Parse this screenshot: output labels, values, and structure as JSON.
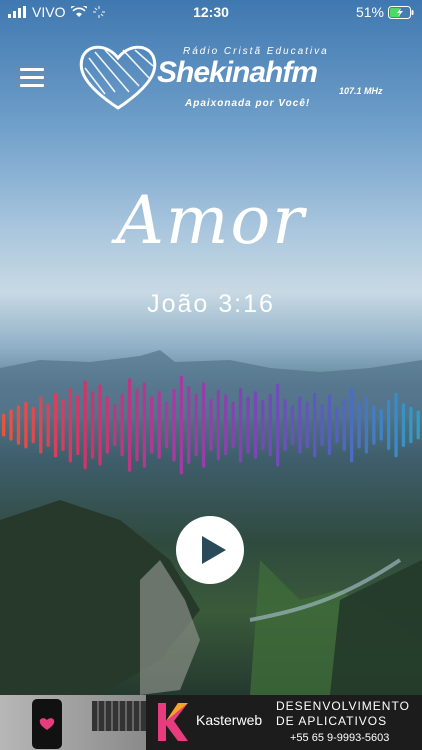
{
  "status_bar": {
    "carrier": "VIVO",
    "time": "12:30",
    "battery": "51%",
    "icons": [
      "signal-icon",
      "wifi-icon",
      "loading-icon",
      "battery-icon"
    ]
  },
  "logo": {
    "tagline": "Rádio Cristã Educativa",
    "name": "Shekinahfm",
    "frequency": "107.1 MHz",
    "slogan": "Apaixonada por Você!",
    "icon": "heart-icon"
  },
  "content": {
    "title": "Amor",
    "verse": "João 3:16"
  },
  "player": {
    "icon": "play-icon",
    "waveform_levels": [
      0.22,
      0.3,
      0.38,
      0.45,
      0.35,
      0.55,
      0.42,
      0.62,
      0.5,
      0.72,
      0.58,
      0.85,
      0.65,
      0.78,
      0.55,
      0.4,
      0.6,
      0.9,
      0.7,
      0.82,
      0.55,
      0.65,
      0.45,
      0.7,
      0.95,
      0.75,
      0.6,
      0.82,
      0.5,
      0.68,
      0.58,
      0.45,
      0.72,
      0.55,
      0.65,
      0.48,
      0.6,
      0.8,
      0.5,
      0.38,
      0.55,
      0.45,
      0.62,
      0.4,
      0.58,
      0.35,
      0.5,
      0.72,
      0.45,
      0.55,
      0.38,
      0.3,
      0.48,
      0.62,
      0.42,
      0.35,
      0.28
    ],
    "waveform_colors": [
      "#e8553f",
      "#d0346b",
      "#a83aa0",
      "#7d45b6",
      "#5560c2",
      "#2e9ec8"
    ]
  },
  "ad": {
    "brand": "Kasterweb",
    "headline1": "DESENVOLVIMENTO",
    "headline2": "DE APLICATIVOS",
    "phone": "+55 65 9-9993-5603",
    "accent_colors": [
      "#f5a623",
      "#e73c7e",
      "#c21f7a"
    ]
  },
  "colors": {
    "sky_top": "#3f78b0",
    "valley": "#2f4a3e",
    "text": "#ffffff"
  }
}
